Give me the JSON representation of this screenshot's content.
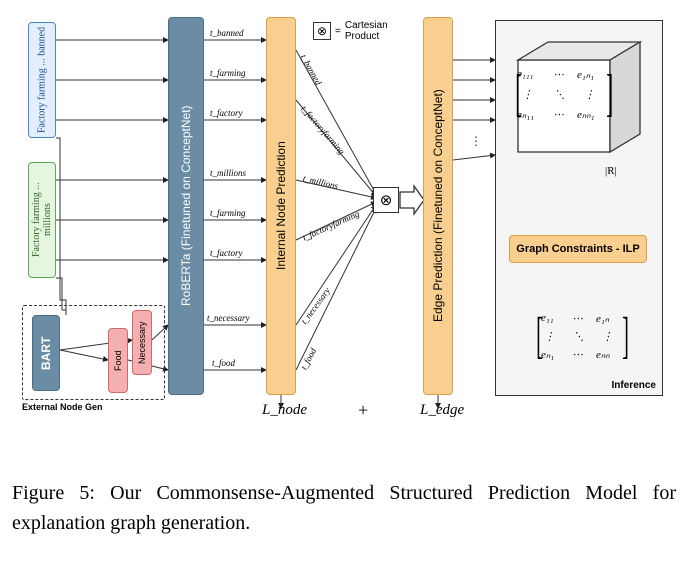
{
  "beliefs": {
    "blue": "Factory farming ... banned",
    "green": "Factory farming ... millions"
  },
  "ext_gen": {
    "label": "External Node Gen",
    "bart": "BART",
    "concepts": [
      "Necessary",
      "Food"
    ]
  },
  "modules": {
    "roberta": "RoBERTa (Finetuned on ConceptNet)",
    "internal_node": "Internal Node Prediction",
    "edge_pred": "Edge Prediction (Finetuned on ConceptNet)"
  },
  "cartesian": {
    "symbol": "⊗",
    "eq": "=",
    "label": "Cartesian Product"
  },
  "t_labels_left": [
    "t_banned",
    "t_farming",
    "t_factory",
    "t_millions",
    "t_farming",
    "t_factory",
    "t_necessary",
    "t_food"
  ],
  "t_labels_right": [
    "t_banned",
    "t_factoryfarming",
    "t_millions",
    "t_factoryfarming",
    "t_necessary",
    "t_food"
  ],
  "losses": {
    "node": "L_node",
    "plus": "+",
    "edge": "L_edge"
  },
  "inference": {
    "constraints": "Graph Constraints - ILP",
    "label": "Inference",
    "r_dim": "|R|",
    "tensor": {
      "e111": "e₁₁₁",
      "e1n1": "e₁ₙ₁",
      "en11": "eₙ₁₁",
      "enn1": "eₙₙ₁",
      "dots_h": "⋯",
      "dots_v": "⋮",
      "dots_d": "⋱"
    },
    "matrix": {
      "e11": "e₁₁",
      "e1n": "e₁ₙ",
      "en1": "eₙ₁",
      "enn": "eₙₙ",
      "dots_h": "⋯",
      "dots_v": "⋮",
      "dots_d": "⋱"
    }
  },
  "caption": "Figure 5: Our Commonsense-Augmented Structured Prediction Model for explanation graph generation.",
  "chart_data": {
    "type": "diagram",
    "title": "Commonsense-Augmented Structured Prediction Model",
    "inputs": [
      {
        "id": "belief",
        "text": "Factory farming ... banned",
        "tokens": [
          "banned",
          "farming",
          "factory"
        ]
      },
      {
        "id": "argument",
        "text": "Factory farming ... millions",
        "tokens": [
          "millions",
          "farming",
          "factory"
        ]
      }
    ],
    "external_node_generator": {
      "model": "BART",
      "generated_concepts": [
        "Necessary",
        "Food"
      ]
    },
    "encoder": "RoBERTa (Finetuned on ConceptNet)",
    "node_tokens": [
      "t_banned",
      "t_farming",
      "t_factory",
      "t_millions",
      "t_farming",
      "t_factory",
      "t_necessary",
      "t_food"
    ],
    "node_prediction_module": "Internal Node Prediction",
    "pooled_nodes": [
      "t_banned",
      "t_factoryfarming",
      "t_millions",
      "t_factoryfarming",
      "t_necessary",
      "t_food"
    ],
    "combine_op": "Cartesian Product",
    "edge_prediction_module": "Edge Prediction (Finetuned on ConceptNet)",
    "edge_output_tensor_shape": "n × n × |R|",
    "decoding": "Graph Constraints - ILP",
    "final_output_shape": "n × n",
    "losses": [
      "L_node",
      "L_edge"
    ],
    "total_loss": "L_node + L_edge"
  }
}
